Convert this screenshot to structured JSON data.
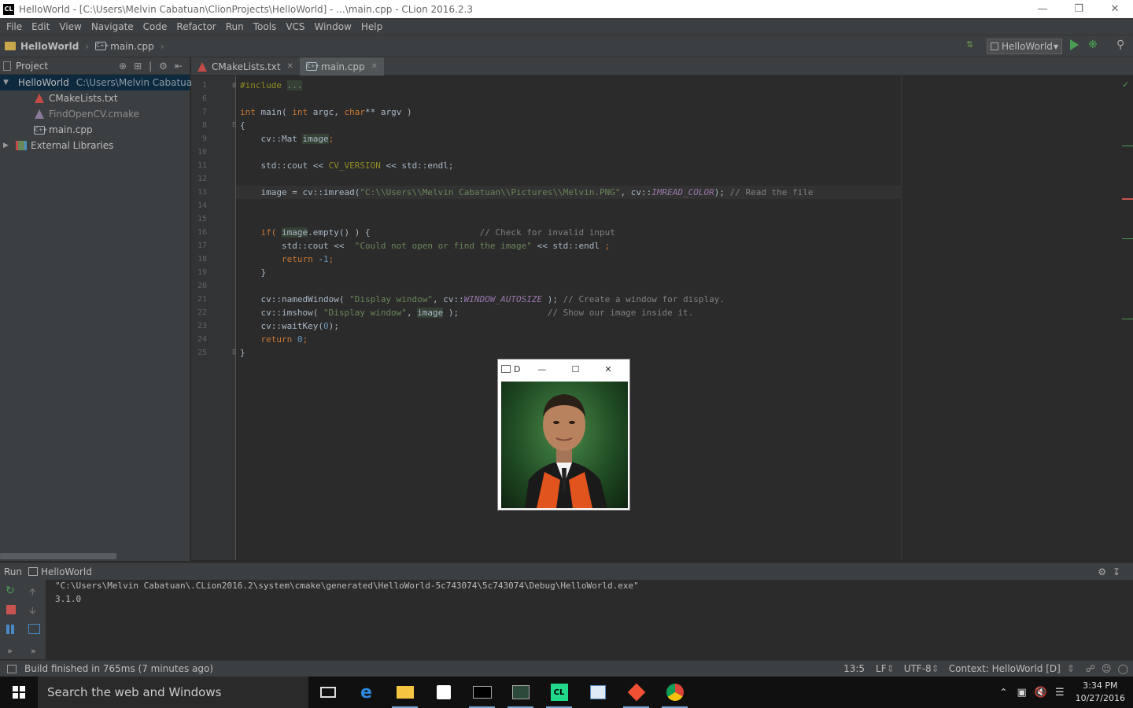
{
  "window": {
    "app_icon": "CL",
    "title": "HelloWorld - [C:\\Users\\Melvin Cabatuan\\ClionProjects\\HelloWorld] - ...\\main.cpp - CLion 2016.2.3"
  },
  "menu": [
    "File",
    "Edit",
    "View",
    "Navigate",
    "Code",
    "Refactor",
    "Run",
    "Tools",
    "VCS",
    "Window",
    "Help"
  ],
  "breadcrumb": {
    "project": "HelloWorld",
    "file": "main.cpp"
  },
  "run_config": {
    "label": "HelloWorld"
  },
  "project_panel": {
    "title": "Project",
    "root": {
      "name": "HelloWorld",
      "path": "C:\\Users\\Melvin Cabatua"
    },
    "files": [
      {
        "name": "CMakeLists.txt",
        "icon": "cmake-icon"
      },
      {
        "name": "FindOpenCV.cmake",
        "icon": "cmake-icon"
      },
      {
        "name": "main.cpp",
        "icon": "cpp-file-icon"
      }
    ],
    "external": "External Libraries"
  },
  "tabs": [
    {
      "label": "CMakeLists.txt",
      "active": false
    },
    {
      "label": "main.cpp",
      "active": true
    }
  ],
  "code": {
    "line_numbers": [
      "1",
      "6",
      "7",
      "8",
      "9",
      "10",
      "11",
      "12",
      "13",
      "14",
      "15",
      "16",
      "17",
      "18",
      "19",
      "20",
      "21",
      "22",
      "23",
      "24",
      "25"
    ],
    "l1_kw": "#include",
    "l1_fold": "...",
    "l7_a": "int",
    "l7_b": " main( ",
    "l7_c": "int",
    "l7_d": " argc, ",
    "l7_e": "char",
    "l7_f": "** argv )",
    "l8": "{",
    "l9_a": "    cv::Mat ",
    "l9_b": "image",
    "l9_c": ";",
    "l11_a": "    std::cout << ",
    "l11_b": "CV_VERSION",
    "l11_c": " << std::endl;",
    "l13_a": "    image = cv::imread(",
    "l13_b": "\"C:\\\\Users\\\\Melvin Cabatuan\\\\Pictures\\\\Melvin.PNG\"",
    "l13_c": ", cv::",
    "l13_d": "IMREAD_COLOR",
    "l13_e": "); ",
    "l13_f": "// Read the file",
    "l16_a": "    if( ",
    "l16_b": "image",
    "l16_c": ".empty() ) {                     ",
    "l16_d": "// Check for invalid input",
    "l17_a": "        std::cout <<  ",
    "l17_b": "\"Could not open or find the image\"",
    "l17_c": " << std::endl ",
    "l17_d": ";",
    "l18_a": "        ",
    "l18_b": "return",
    "l18_c": " -",
    "l18_d": "1",
    "l18_e": ";",
    "l19": "    }",
    "l21_a": "    cv::namedWindow( ",
    "l21_b": "\"Display window\"",
    "l21_c": ", cv::",
    "l21_d": "WINDOW_AUTOSIZE",
    "l21_e": " ); ",
    "l21_f": "// Create a window for display.",
    "l22_a": "    cv::imshow( ",
    "l22_b": "\"Display window\"",
    "l22_c": ", ",
    "l22_d": "image",
    "l22_e": " );                 ",
    "l22_f": "// Show our image inside it.",
    "l23_a": "    cv::waitKey(",
    "l23_b": "0",
    "l23_c": ");",
    "l24_a": "    ",
    "l24_b": "return",
    "l24_c": " ",
    "l24_d": "0",
    "l24_e": ";",
    "l25": "}"
  },
  "image_window": {
    "title": "D"
  },
  "run_panel": {
    "tab_label": "Run",
    "config": "HelloWorld",
    "output_path": "\"C:\\Users\\Melvin Cabatuan\\.CLion2016.2\\system\\cmake\\generated\\HelloWorld-5c743074\\5c743074\\Debug\\HelloWorld.exe\"",
    "output_version": "3.1.0"
  },
  "status": {
    "message": "Build finished in 765ms (7 minutes ago)",
    "position": "13:5",
    "line_sep": "LF",
    "encoding": "UTF-8",
    "context": "Context: HelloWorld [D]"
  },
  "taskbar": {
    "search_placeholder": "Search the web and Windows",
    "time": "3:34 PM",
    "date": "10/27/2016"
  }
}
